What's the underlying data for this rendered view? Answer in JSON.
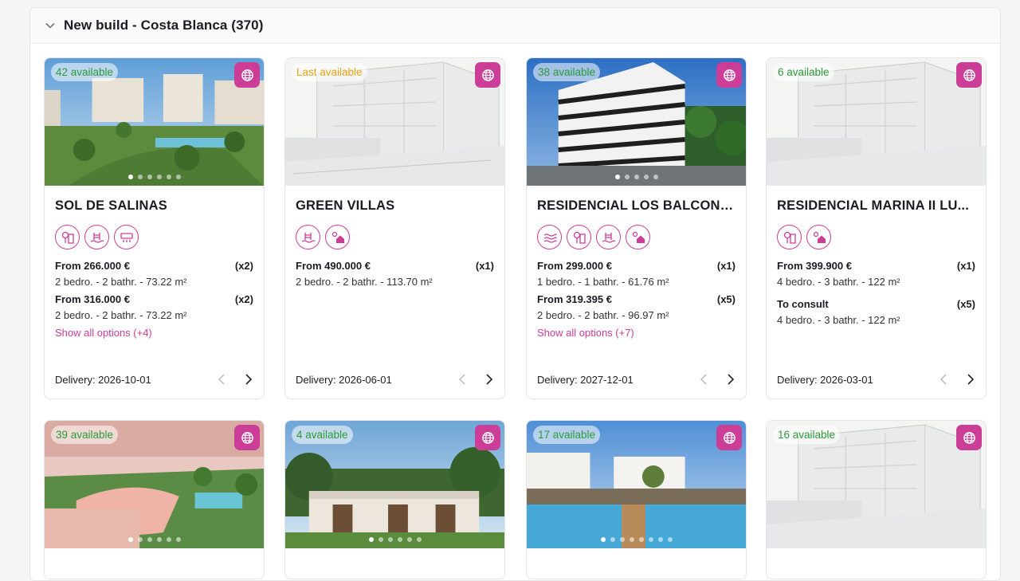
{
  "section": {
    "title": "New build - Costa Blanca (370)"
  },
  "cards": [
    {
      "availability": "42 available",
      "name": "SOL DE SALINAS",
      "amenities": [
        "garden-icon",
        "pool-icon",
        "air-conditioning-icon"
      ],
      "options": [
        {
          "price": "From 266.000 €",
          "count": "(x2)",
          "details": "2 bedro. - 2 bathr. - 73.22 m²"
        },
        {
          "price": "From 316.000 €",
          "count": "(x2)",
          "details": "2 bedro. - 2 bathr. - 73.22 m²"
        }
      ],
      "more": "Show all options (+4)",
      "delivery": "Delivery: 2026-10-01"
    },
    {
      "availability": "Last available",
      "name": "GREEN VILLAS",
      "amenities": [
        "pool-icon",
        "solar-house-icon"
      ],
      "options": [
        {
          "price": "From 490.000 €",
          "count": "(x1)",
          "details": "2 bedro. - 2 bathr. - 113.70 m²"
        }
      ],
      "more": "",
      "delivery": "Delivery: 2026-06-01"
    },
    {
      "availability": "38 available",
      "name": "RESIDENCIAL LOS BALCONE...",
      "amenities": [
        "sea-icon",
        "garden-icon",
        "pool-icon",
        "solar-house-icon"
      ],
      "options": [
        {
          "price": "From 299.000 €",
          "count": "(x1)",
          "details": "1 bedro. - 1 bathr. - 61.76 m²"
        },
        {
          "price": "From 319.395 €",
          "count": "(x5)",
          "details": "2 bedro. - 2 bathr. - 96.97 m²"
        }
      ],
      "more": "Show all options (+7)",
      "delivery": "Delivery: 2027-12-01"
    },
    {
      "availability": "6 available",
      "name": "RESIDENCIAL MARINA II LU...",
      "amenities": [
        "garden-icon",
        "solar-house-icon"
      ],
      "options": [
        {
          "price": "From 399.900 €",
          "count": "(x1)",
          "details": "4 bedro. - 3 bathr. - 122 m²"
        },
        {
          "price": "To consult",
          "count": "(x5)",
          "details": "4 bedro. - 3 bathr. - 122 m²"
        }
      ],
      "more": "",
      "delivery": "Delivery: 2026-03-01"
    },
    {
      "availability": "39 available"
    },
    {
      "availability": "4 available"
    },
    {
      "availability": "17 available"
    },
    {
      "availability": "16 available"
    }
  ]
}
